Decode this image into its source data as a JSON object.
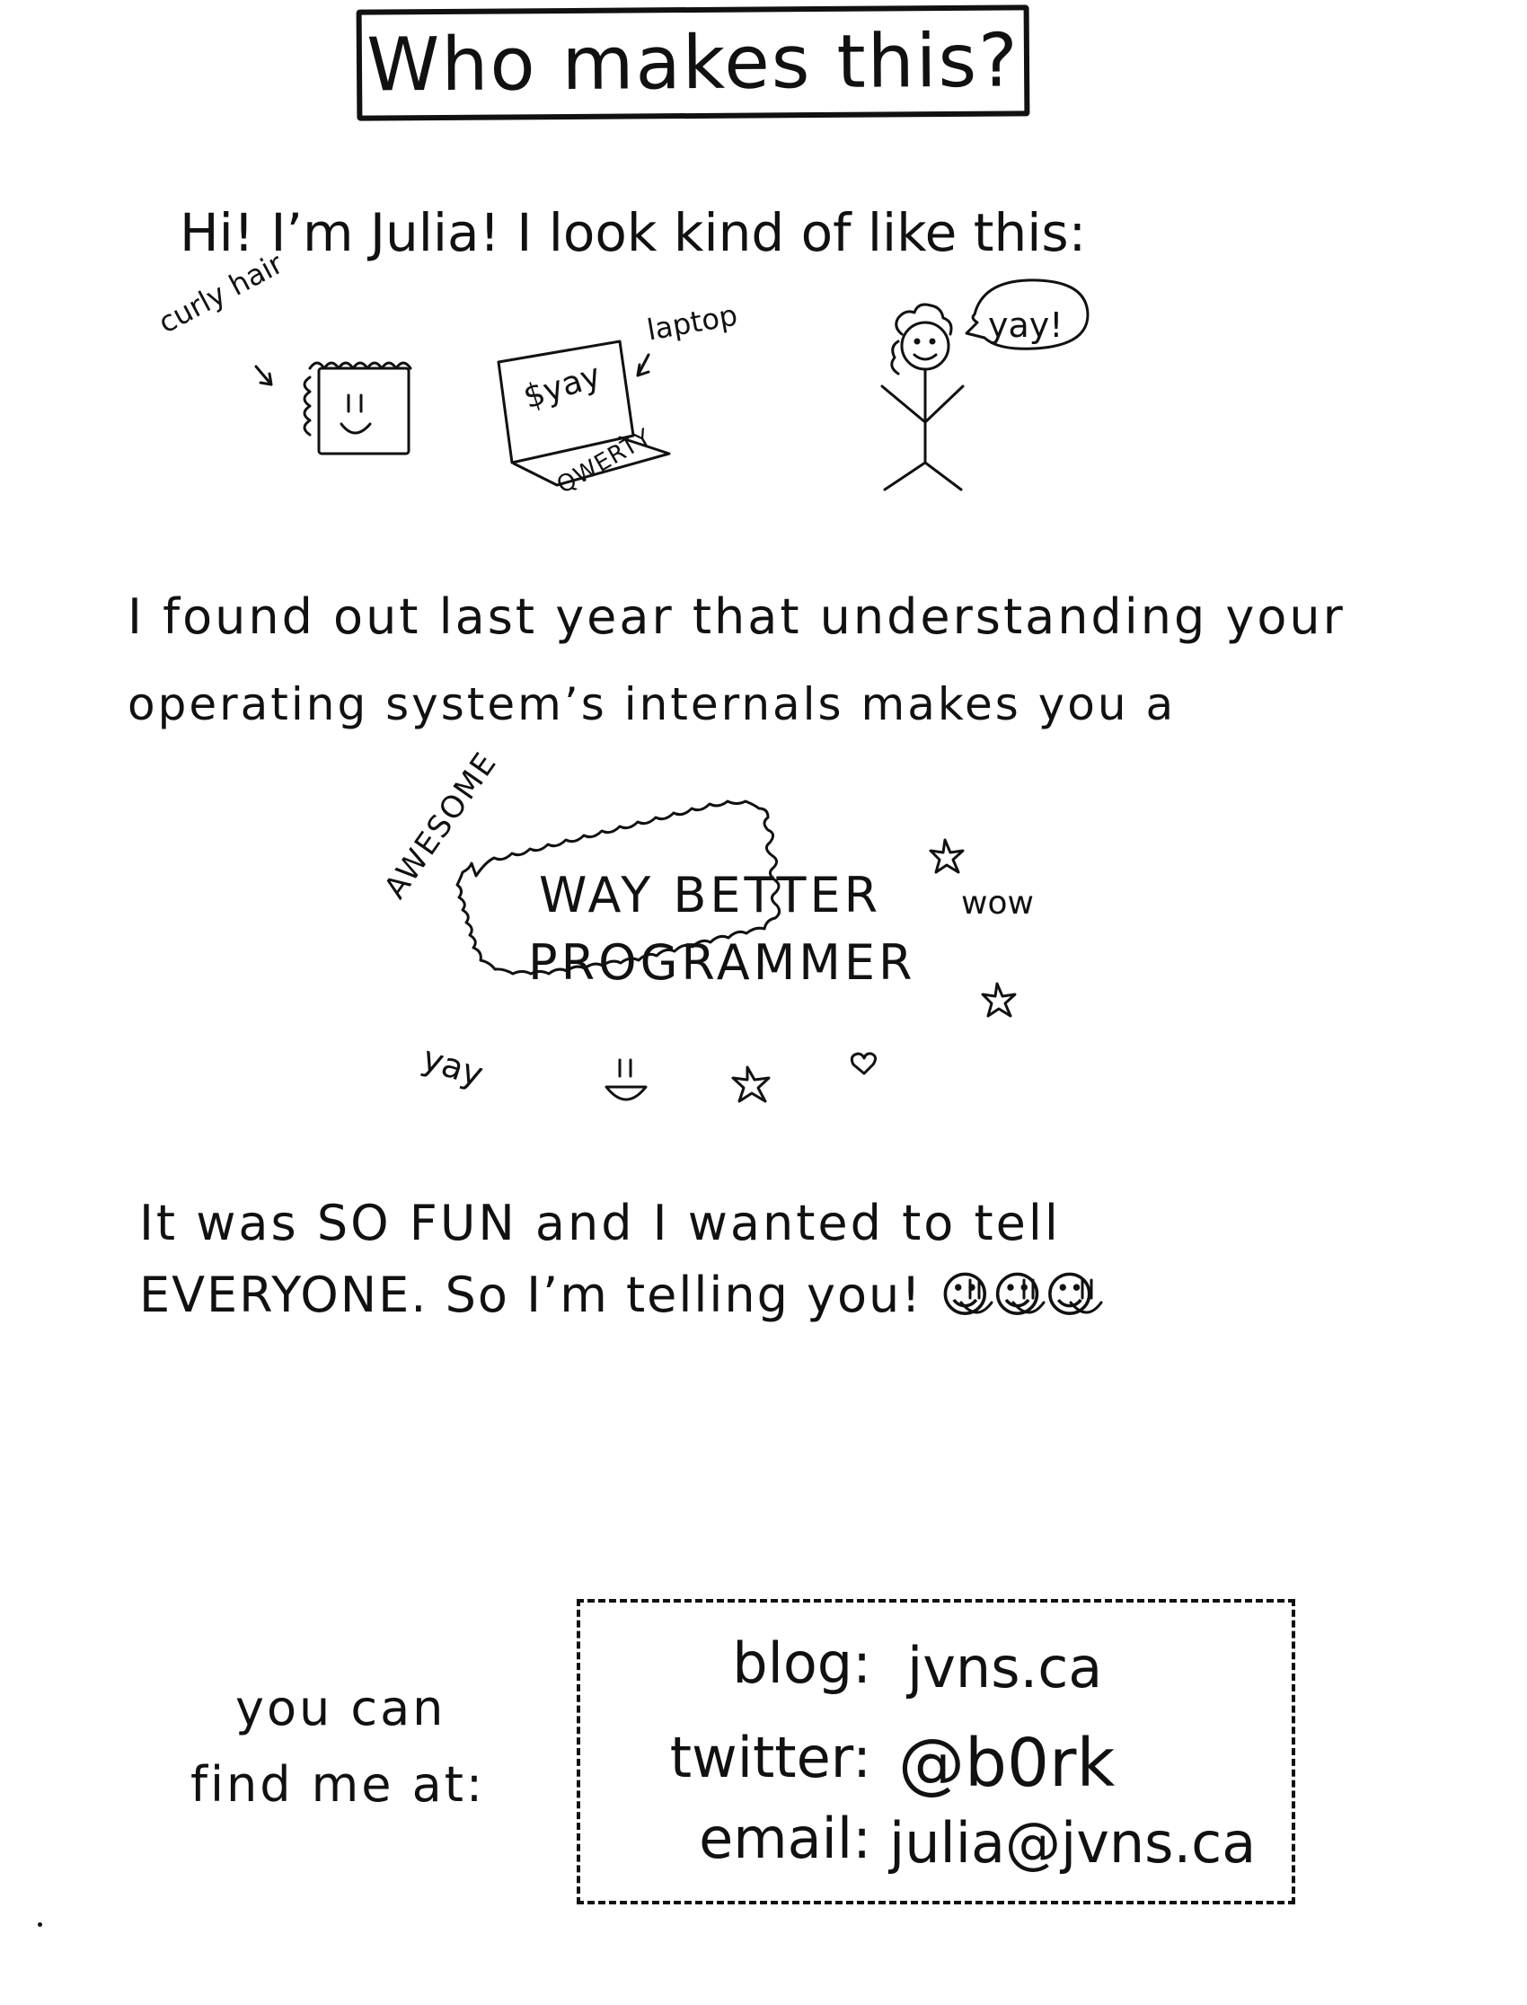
{
  "title": "Who makes this?",
  "intro": "Hi! I’m Julia! I look kind of like this:",
  "doodles": {
    "curly_hair_label": "curly hair",
    "laptop_label": "laptop",
    "laptop_screen_text": "$yay",
    "keyboard_label": "QWERTY",
    "speech_bubble_text": "yay!"
  },
  "paragraph1": {
    "line1": "I found out last year that understanding your",
    "line2": "operating system’s internals makes you a"
  },
  "burst": {
    "line1": "WAY BETTER",
    "line2": "PROGRAMMER",
    "awesome_label": "AWESOME",
    "wow_label": "wow",
    "yay_label": "yay"
  },
  "paragraph2": {
    "line1": "It was SO FUN and I wanted to tell",
    "line2": "EVERYONE. So I’m telling you! ☺☺☺"
  },
  "find_me": {
    "line1": "you can",
    "line2": "find me at:"
  },
  "contact": {
    "blog_label": "blog:",
    "blog_value": "jvns.ca",
    "twitter_label": "twitter:",
    "twitter_value": "@b0rk",
    "email_label": "email:",
    "email_value": "julia@jvns.ca"
  }
}
